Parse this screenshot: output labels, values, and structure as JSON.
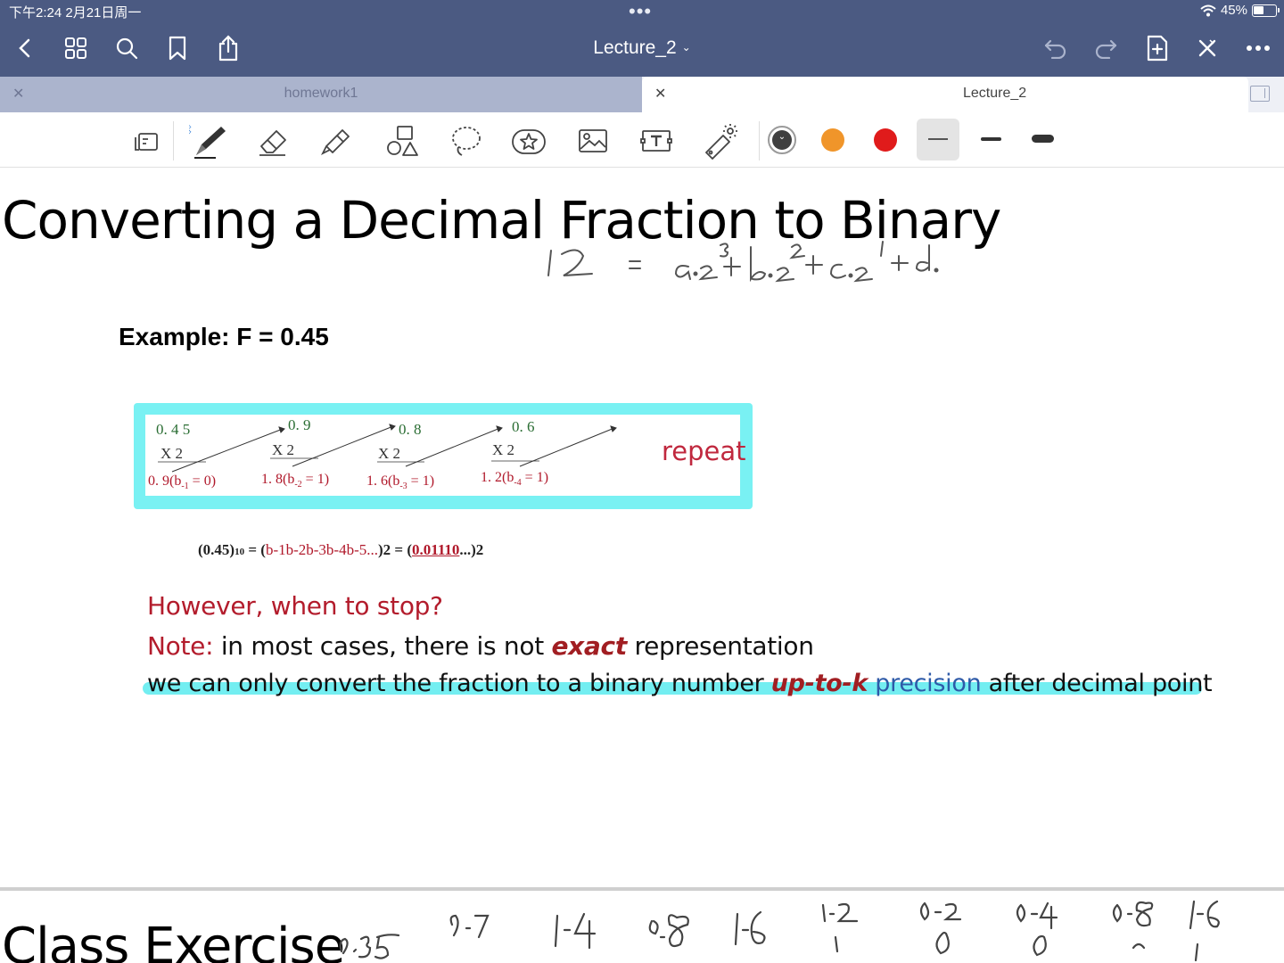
{
  "status_bar": {
    "time": "下午2:24  2月21日周一",
    "battery_percent": "45%"
  },
  "header": {
    "title": "Lecture_2"
  },
  "tabs": [
    {
      "label": "homework1",
      "active": false
    },
    {
      "label": "Lecture_2",
      "active": true
    }
  ],
  "toolbar": {
    "tools": [
      "page-mode-icon",
      "pen-icon",
      "eraser-icon",
      "highlighter-icon",
      "shapes-icon",
      "lasso-icon",
      "sticker-icon",
      "image-icon",
      "text-icon",
      "laser-pointer-icon"
    ],
    "selected_tool": "pen-icon",
    "colors": [
      "#404040",
      "#f0952a",
      "#e01b1b"
    ],
    "selected_color": "#404040",
    "stroke_widths": [
      "thin",
      "medium",
      "thick"
    ],
    "selected_width": "thin"
  },
  "slide": {
    "title": "Converting a  Decimal Fraction to Binary",
    "example": "Example: F = 0.45",
    "steps": [
      {
        "top": "0. 4  5",
        "times": "X     2",
        "result": "0. 9(b",
        "sub": "-1",
        "tail": " = 0)"
      },
      {
        "top": "0. 9",
        "times": "X     2",
        "result": "1. 8(b",
        "sub": "-2",
        "tail": " = 1)"
      },
      {
        "top": "0. 8",
        "times": "X     2",
        "result": "1. 6(b",
        "sub": "-3",
        "tail": " = 1)"
      },
      {
        "top": "0. 6",
        "times": "X     2",
        "result": "1. 2(b",
        "sub": "-4",
        "tail": " = 1)"
      }
    ],
    "repeat_label": "repeat",
    "formula": {
      "lhs": "(0.45)",
      "lhs_base": "10",
      "eq": " = (",
      "bits": "b-1b-2b-3b-4b-5...",
      "rhs_open": ")2 = (",
      "rhs_bits": "0.01110",
      "rhs_tail": "...)2"
    },
    "question": "However, when to stop?",
    "note_label": "Note:",
    "note_text_1": " in most cases, there is not ",
    "note_emph": "exact",
    "note_text_2": " representation",
    "line3_text_1": "we can only convert the fraction to a binary number ",
    "line3_emph": "up-to-k",
    "line3_blue": " precision",
    "line3_text_2": " after decimal point"
  },
  "next_slide": {
    "title": "Class Exercise"
  },
  "colors": {
    "header_bg": "#4b5a82",
    "highlight": "#73eef1",
    "accent_red": "#b31c2c"
  }
}
